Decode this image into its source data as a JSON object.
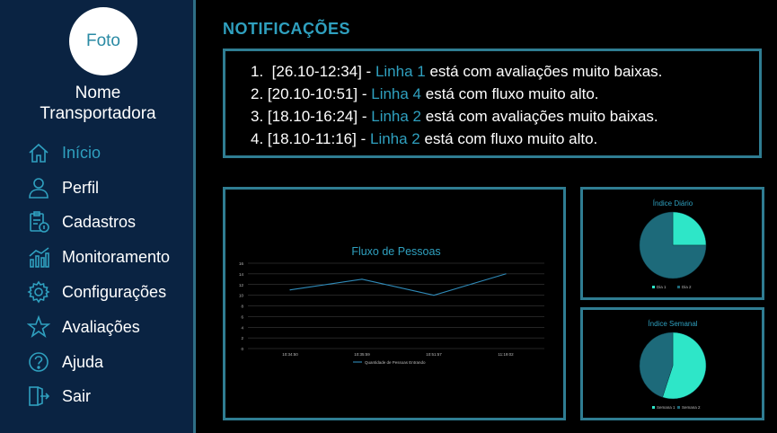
{
  "sidebar": {
    "avatar_label": "Foto",
    "company_line1": "Nome",
    "company_line2": "Transportadora",
    "items": [
      {
        "label": "Início",
        "icon": "home-icon",
        "active": true
      },
      {
        "label": "Perfil",
        "icon": "user-icon"
      },
      {
        "label": "Cadastros",
        "icon": "clipboard-icon"
      },
      {
        "label": "Monitoramento",
        "icon": "chart-icon"
      },
      {
        "label": "Configurações",
        "icon": "gear-icon"
      },
      {
        "label": "Avaliações",
        "icon": "star-icon"
      },
      {
        "label": "Ajuda",
        "icon": "help-icon"
      },
      {
        "label": "Sair",
        "icon": "logout-icon"
      }
    ]
  },
  "notifications": {
    "title": "NOTIFICAÇÕES",
    "items": [
      {
        "num": "1.",
        "stamp": "[26.10-12:34] -",
        "line": "Linha 1",
        "text": "está com avaliações muito baixas."
      },
      {
        "num": "2.",
        "stamp": "[20.10-10:51] -",
        "line": "Linha 4",
        "text": "está com fluxo muito alto."
      },
      {
        "num": "3.",
        "stamp": "[18.10-16:24] -",
        "line": "Linha 2",
        "text": "está com avaliações muito baixas."
      },
      {
        "num": "4.",
        "stamp": "[18.10-11:16] -",
        "line": "Linha 2",
        "text": "está com fluxo muito alto."
      }
    ]
  },
  "colors": {
    "accent": "#2fa0bf",
    "sidebar_bg": "#0a2342",
    "line_series": "#2f8ab8",
    "pie_dark": "#1d6a7a",
    "pie_light": "#2ee6c8"
  },
  "chart_data": [
    {
      "type": "line",
      "title": "Fluxo de Pessoas",
      "categories": [
        "10:34:50",
        "10:35:59",
        "10:51:57",
        "11:19:02"
      ],
      "series": [
        {
          "name": "Quantidade de Pessoas Entrando",
          "values": [
            11,
            13,
            10,
            14
          ]
        }
      ],
      "ylim": [
        0,
        16
      ],
      "yticks": [
        0,
        2,
        4,
        6,
        8,
        10,
        12,
        14,
        16
      ],
      "grid": true,
      "legend": "bottom"
    },
    {
      "type": "pie",
      "title": "Índice Diário",
      "labels": [
        "Dia 1",
        "Dia 2"
      ],
      "values": [
        25,
        75
      ],
      "legend": "bottom"
    },
    {
      "type": "pie",
      "title": "Índice Semanal",
      "labels": [
        "Semana 1",
        "Semana 2"
      ],
      "values": [
        55,
        45
      ],
      "legend": "bottom"
    }
  ]
}
